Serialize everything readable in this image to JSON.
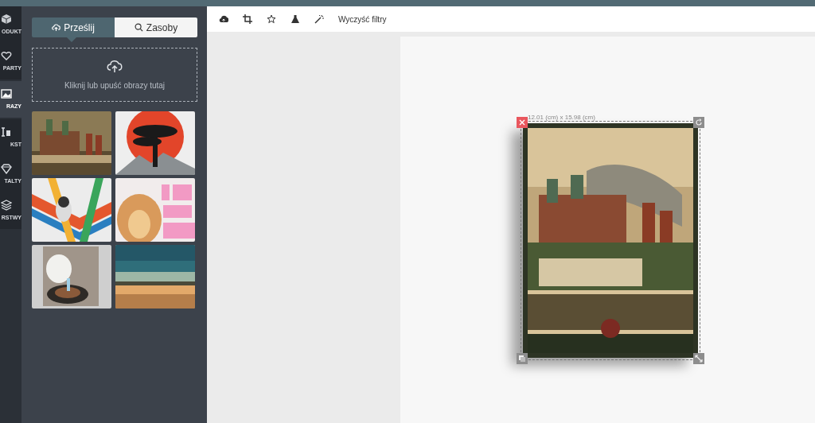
{
  "sidebar": {
    "items": [
      {
        "label": "ODUKT",
        "selected": false
      },
      {
        "label": "PARTY",
        "selected": false
      },
      {
        "label": "RAZY",
        "selected": true
      },
      {
        "label": "KST",
        "selected": false
      },
      {
        "label": "TALTY",
        "selected": false
      },
      {
        "label": "RSTWY",
        "selected": false
      }
    ]
  },
  "panel": {
    "tabs": [
      {
        "label": "Prześlij",
        "selected": true
      },
      {
        "label": "Zasoby",
        "selected": false
      }
    ],
    "dropzone": {
      "text": "Kliknij lub upuść obrazy tutaj"
    }
  },
  "toolbar": {
    "clear_filters": "Wyczyść filtry"
  },
  "canvas": {
    "dimensions": "12.01 (cm) x 15.98 (cm)",
    "selected": true
  }
}
